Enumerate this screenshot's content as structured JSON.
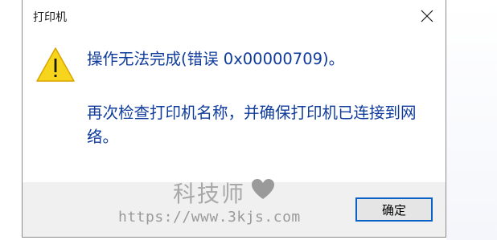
{
  "window": {
    "title": "打印机"
  },
  "message": {
    "main": "操作无法完成(错误 0x00000709)。",
    "detail": "再次检查打印机名称，并确保打印机已连接到网络。"
  },
  "buttons": {
    "ok_label": "确定"
  },
  "icons": {
    "warning": "warning-icon",
    "close": "close-icon"
  },
  "watermark": {
    "brand": "科技师",
    "url": "https://www.3kjs.com"
  },
  "colors": {
    "message_text": "#0f3b9c",
    "warning_fill": "#f7d51c",
    "button_focus_border": "#0a62c7",
    "footer_bg": "#f0f0f0"
  }
}
